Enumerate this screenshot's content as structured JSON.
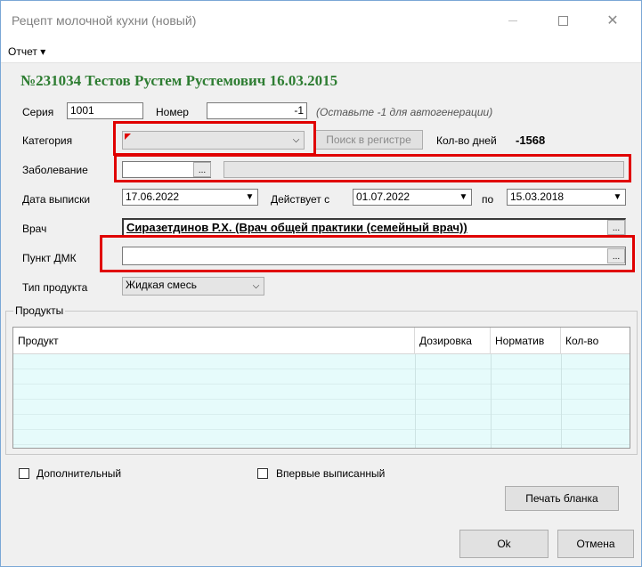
{
  "window": {
    "title": "Рецепт молочной кухни (новый)"
  },
  "menu": {
    "report_label": "Отчет ▾"
  },
  "header": {
    "heading": "№231034 Тестов Рустем Рустемович 16.03.2015"
  },
  "form": {
    "series_label": "Серия",
    "series_value": "1001",
    "number_label": "Номер",
    "number_value": "-1",
    "number_hint": "(Оставьте -1 для автогенерации)",
    "category_label": "Категория",
    "category_value": "",
    "search_registry_label": "Поиск в регистре",
    "days_label": "Кол-во дней",
    "days_value": "-1568",
    "disease_label": "Заболевание",
    "disease_code": "",
    "disease_name": "",
    "issue_date_label": "Дата выписки",
    "issue_date_value": "17.06.2022",
    "valid_from_label": "Действует с",
    "valid_from_value": "01.07.2022",
    "valid_to_label": "по",
    "valid_to_value": "15.03.2018",
    "doctor_label": "Врач",
    "doctor_value": "Сиразетдинов Р.Х. (Врач общей практики (семейный врач))",
    "dmk_label": "Пункт ДМК",
    "dmk_value": "",
    "product_type_label": "Тип продукта",
    "product_type_value": "Жидкая смесь"
  },
  "products": {
    "group_title": "Продукты",
    "columns": [
      "Продукт",
      "Дозировка",
      "Норматив",
      "Кол-во"
    ]
  },
  "options": {
    "additional_label": "Дополнительный",
    "first_issued_label": "Впервые выписанный"
  },
  "buttons": {
    "print_label": "Печать бланка",
    "ok_label": "Ok",
    "cancel_label": "Отмена"
  },
  "colors": {
    "heading": "#2e7d32",
    "highlight": "#e00000",
    "grid_bg": "#e6fbfb"
  }
}
